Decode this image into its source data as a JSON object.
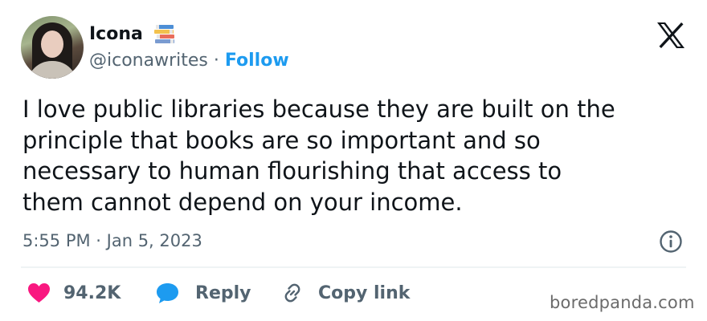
{
  "author": {
    "name": "Icona",
    "name_icon": "books-icon",
    "handle": "@iconawrites",
    "separator": "·",
    "follow_label": "Follow"
  },
  "platform_icon": "x-logo-icon",
  "tweet": {
    "lines": [
      "I love public libraries because they are built on the",
      "principle that books are so important and so",
      "necessary to human flourishing that access to",
      "them cannot depend on your income."
    ],
    "timestamp": "5:55 PM · Jan 5, 2023"
  },
  "actions": {
    "like_count": "94.2K",
    "reply_label": "Reply",
    "copy_link_label": "Copy link"
  },
  "watermark": "boredpanda.com",
  "colors": {
    "accent": "#1d9bf0",
    "like": "#f91880",
    "text": "#0f1419",
    "secondary": "#536471"
  }
}
